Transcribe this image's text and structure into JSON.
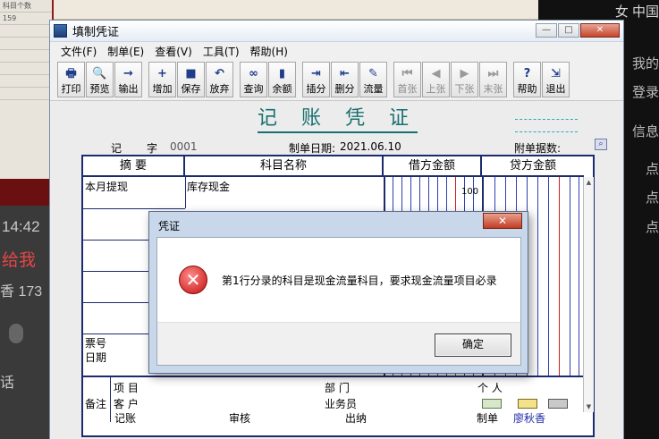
{
  "background": {
    "time": "14:42",
    "left_text": "给我",
    "fragment": "香 173",
    "right_top": "女  中国",
    "right_fragments": [
      "我的",
      "登录",
      "信息",
      "点",
      "点",
      "点"
    ],
    "old_window_rows": [
      "科目个数",
      "159"
    ]
  },
  "window": {
    "title": "填制凭证",
    "controls": {
      "minimize": "—",
      "maximize": "□",
      "close": "✕"
    }
  },
  "menu": [
    "文件(F)",
    "制单(E)",
    "查看(V)",
    "工具(T)",
    "帮助(H)"
  ],
  "toolbar": [
    {
      "label": "打印",
      "icon": "printer-icon",
      "glyph": "🖶",
      "enabled": true
    },
    {
      "label": "预览",
      "icon": "preview-icon",
      "glyph": "🔍",
      "enabled": true
    },
    {
      "label": "输出",
      "icon": "export-icon",
      "glyph": "→",
      "enabled": true
    },
    {
      "label": "增加",
      "icon": "add-icon",
      "glyph": "+",
      "enabled": true
    },
    {
      "label": "保存",
      "icon": "save-icon",
      "glyph": "■",
      "enabled": true
    },
    {
      "label": "放弃",
      "icon": "undo-icon",
      "glyph": "↶",
      "enabled": true
    },
    {
      "label": "查询",
      "icon": "binoculars-icon",
      "glyph": "∞",
      "enabled": true
    },
    {
      "label": "余额",
      "icon": "balance-chart-icon",
      "glyph": "▮",
      "enabled": true
    },
    {
      "label": "插分",
      "icon": "insert-row-icon",
      "glyph": "⇥",
      "enabled": true
    },
    {
      "label": "删分",
      "icon": "delete-row-icon",
      "glyph": "⇤",
      "enabled": true
    },
    {
      "label": "流量",
      "icon": "cashflow-icon",
      "glyph": "✎",
      "enabled": true
    },
    {
      "label": "首张",
      "icon": "first-icon",
      "glyph": "⏮",
      "enabled": false
    },
    {
      "label": "上张",
      "icon": "prev-icon",
      "glyph": "◀",
      "enabled": false
    },
    {
      "label": "下张",
      "icon": "next-icon",
      "glyph": "▶",
      "enabled": false
    },
    {
      "label": "末张",
      "icon": "last-icon",
      "glyph": "⏭",
      "enabled": false
    },
    {
      "label": "帮助",
      "icon": "help-icon",
      "glyph": "?",
      "enabled": true
    },
    {
      "label": "退出",
      "icon": "exit-icon",
      "glyph": "⇲",
      "enabled": true
    }
  ],
  "voucher": {
    "title": "记 账 凭 证",
    "word_label": "记",
    "word_suffix": "字",
    "number": "0001",
    "date_label": "制单日期:",
    "date": "2021.06.10",
    "attachments_label": "附单据数:",
    "columns": [
      "摘 要",
      "科目名称",
      "借方金额",
      "贷方金额"
    ],
    "rows": [
      {
        "summary": "本月提现",
        "account": "库存现金",
        "debit": "100",
        "credit": ""
      }
    ],
    "ticket_label": "票号",
    "date_row_label": "日期",
    "note_label": "备注",
    "project_label": "项  目",
    "customer_label": "客  户",
    "dept_label": "部  门",
    "salesman_label": "业务员",
    "person_label": "个  人",
    "footer": {
      "bookkeeping": "记账",
      "audit": "审核",
      "cashier": "出纳",
      "maker_label": "制单",
      "maker": "廖秋香"
    }
  },
  "dialog": {
    "title": "凭证",
    "message": "第1行分录的科目是现金流量科目，要求现金流量项目必录",
    "ok": "确定",
    "close": "✕"
  }
}
